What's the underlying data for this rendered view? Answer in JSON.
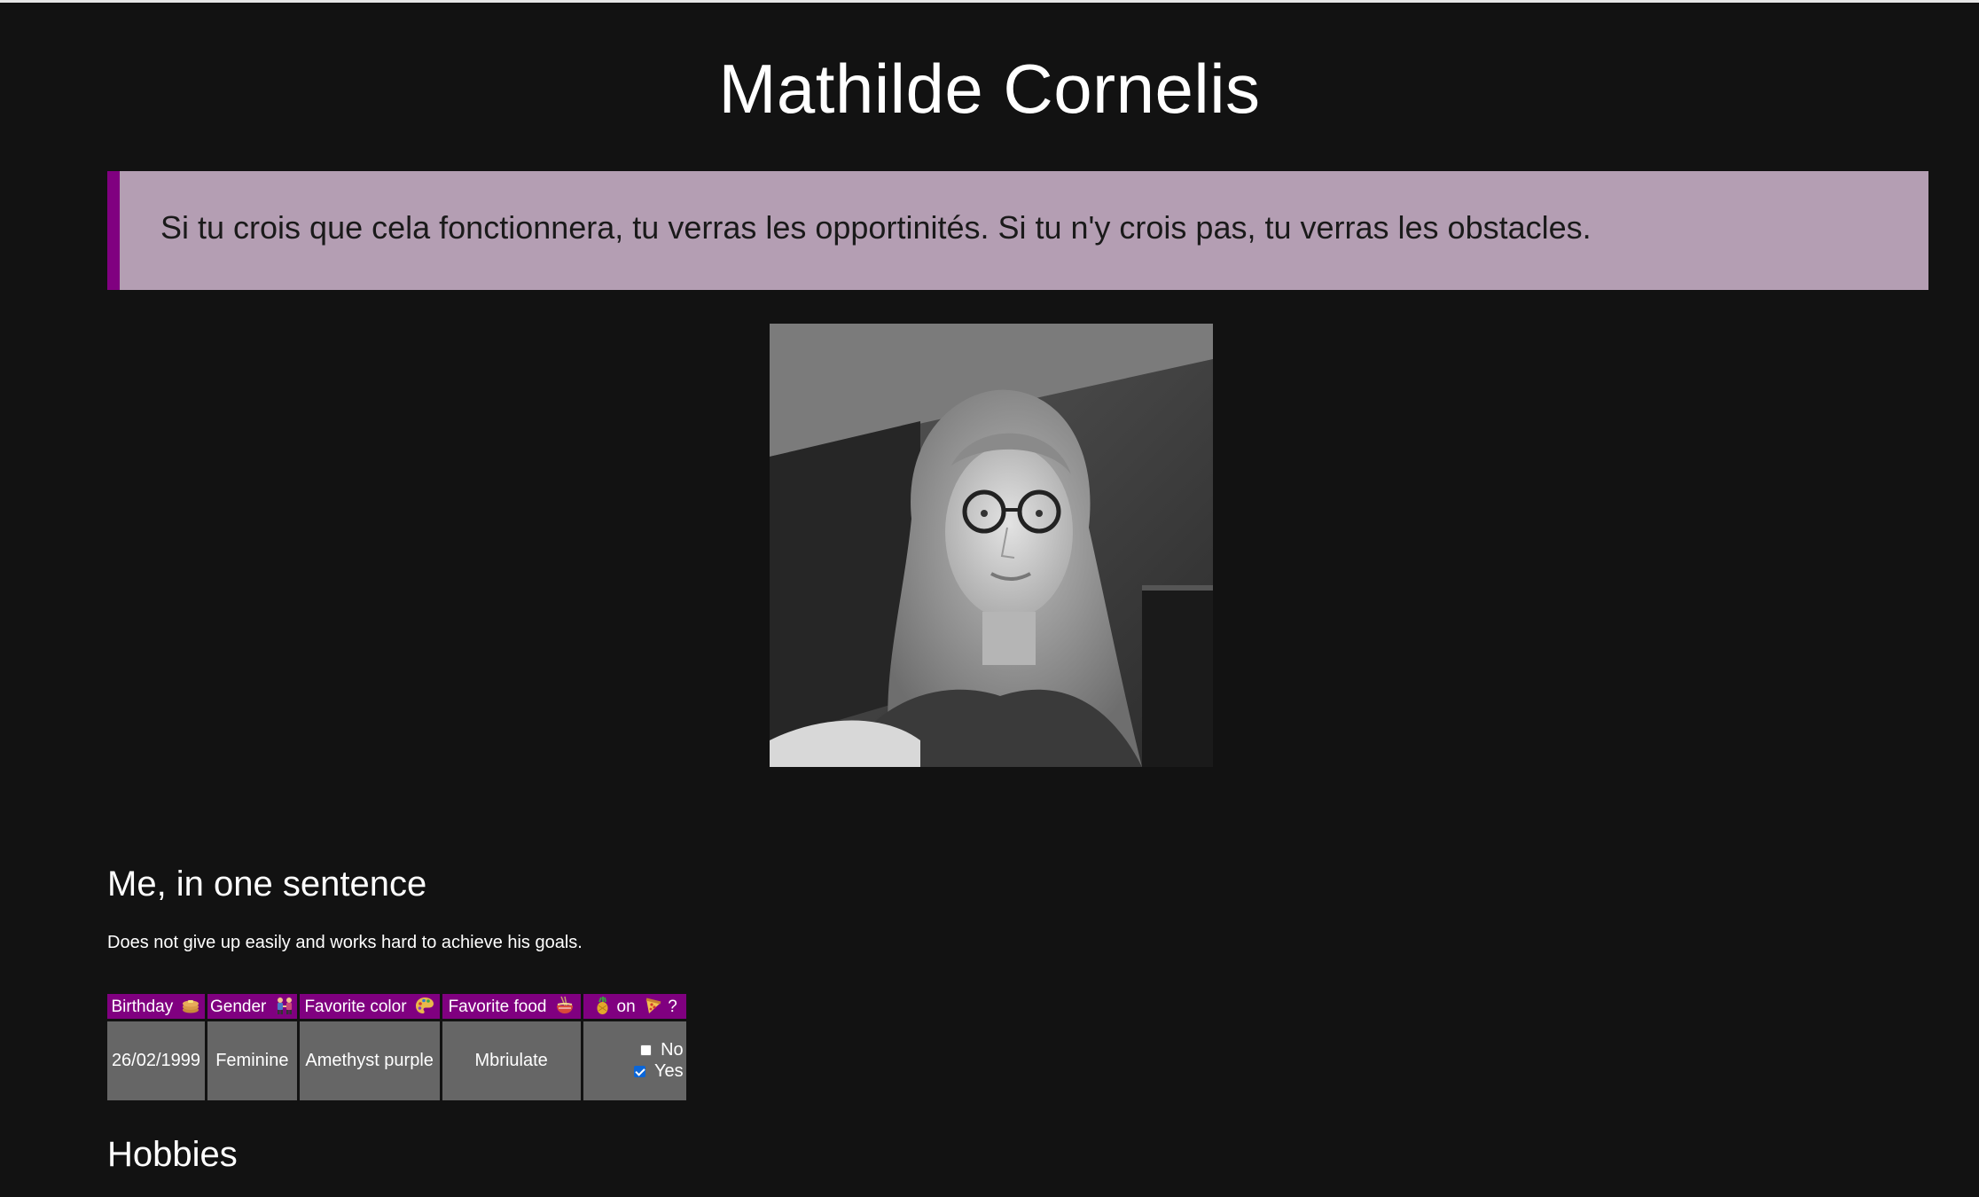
{
  "page": {
    "title": "Mathilde Cornelis",
    "quote": "Si tu crois que cela fonctionnera, tu verras les opportinités. Si tu n'y crois pas, tu verras les obstacles."
  },
  "colors": {
    "background": "#121212",
    "accent": "#800080",
    "quote_background": "#b49eb3",
    "cell_background": "#666666"
  },
  "about": {
    "heading": "Me, in one sentence",
    "sentence": "Does not give up easily and works hard to achieve his goals."
  },
  "info_table": {
    "headers": [
      {
        "label": "Birthday",
        "icon": "pancakes-icon"
      },
      {
        "label": "Gender",
        "icon": "people-holding-hands-icon"
      },
      {
        "label": "Favorite color",
        "icon": "artist-palette-icon"
      },
      {
        "label": "Favorite food",
        "icon": "noodle-bowl-icon"
      },
      {
        "label_prefix_icon": "pineapple-icon",
        "label": "on",
        "suffix_icon": "pizza-icon",
        "label_suffix": "?"
      }
    ],
    "values": {
      "birthday": "26/02/1999",
      "gender": "Feminine",
      "favorite_color": "Amethyst purple",
      "favorite_food": "Mbriulate"
    },
    "pineapple_options": [
      {
        "label": "No",
        "checked": false
      },
      {
        "label": "Yes",
        "checked": true
      }
    ]
  },
  "hobbies": {
    "heading": "Hobbies"
  }
}
